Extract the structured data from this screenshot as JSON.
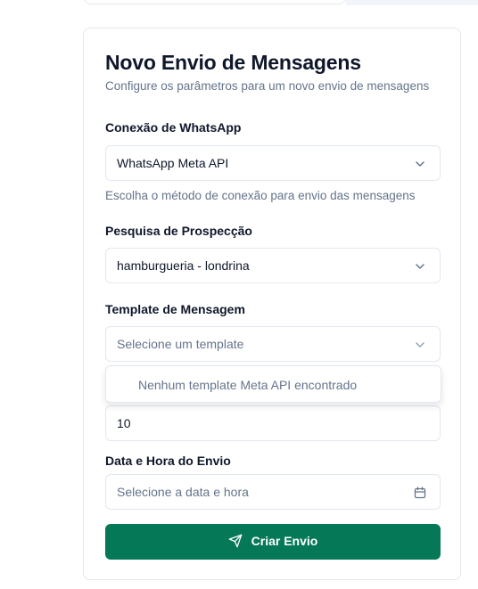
{
  "form": {
    "title": "Novo Envio de Mensagens",
    "subtitle": "Configure os parâmetros para um novo envio de mensagens",
    "connection": {
      "label": "Conexão de WhatsApp",
      "value": "WhatsApp Meta API",
      "help": "Escolha o método de conexão para envio das mensagens"
    },
    "search": {
      "label": "Pesquisa de Prospecção",
      "value": "hamburgueria - londrina"
    },
    "template": {
      "label": "Template de Mensagem",
      "placeholder": "Selecione um template",
      "dropdown_empty": "Nenhum template Meta API encontrado"
    },
    "quantity": {
      "value": "10"
    },
    "datetime": {
      "label": "Data e Hora do Envio",
      "placeholder": "Selecione a data e hora"
    },
    "submit_label": "Criar Envio"
  },
  "colors": {
    "primary": "#047857",
    "border": "#e2e8f0",
    "muted": "#64748b",
    "text": "#0f172a"
  },
  "icons": {
    "select_chevron": "chevron-down-icon",
    "calendar": "calendar-icon",
    "send": "send-icon"
  }
}
